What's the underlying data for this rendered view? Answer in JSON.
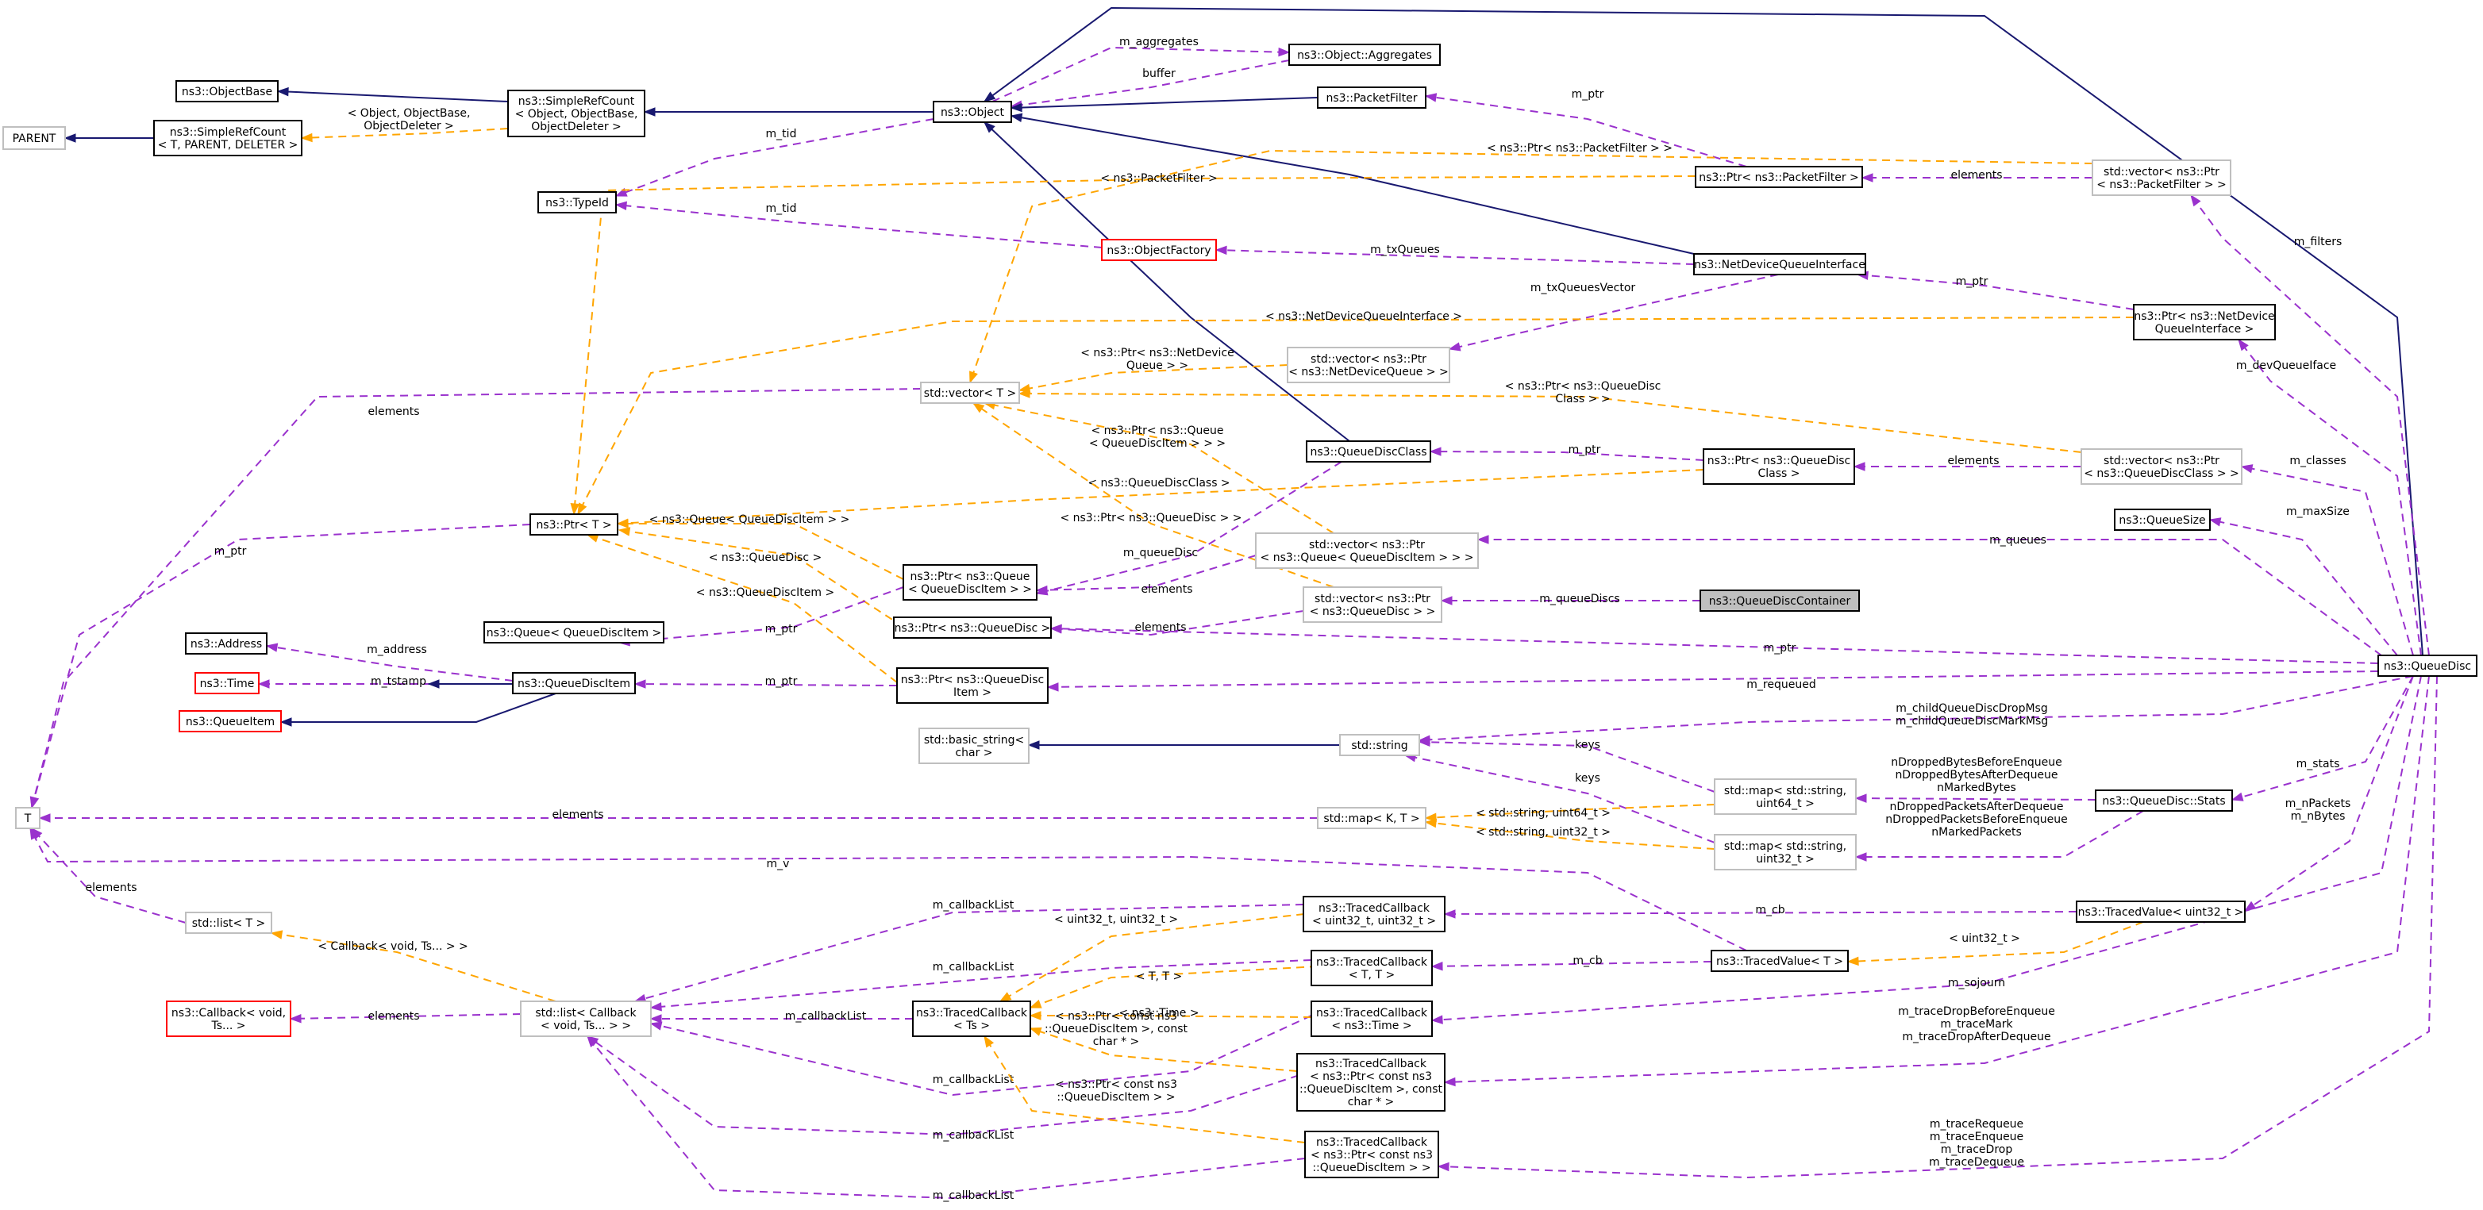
{
  "nodes": {
    "parent": [
      "PARENT"
    ],
    "objectbase": [
      "ns3::ObjectBase"
    ],
    "srcT": [
      "ns3::SimpleRefCount",
      "< T, PARENT, DELETER >"
    ],
    "srcObj": [
      "ns3::SimpleRefCount",
      "< Object, ObjectBase,",
      "ObjectDeleter >"
    ],
    "object": [
      "ns3::Object"
    ],
    "aggregates": [
      "ns3::Object::Aggregates"
    ],
    "packetfilter": [
      "ns3::PacketFilter"
    ],
    "typeid": [
      "ns3::TypeId"
    ],
    "objectfactory": [
      "ns3::ObjectFactory"
    ],
    "ptrPacketFilter": [
      "ns3::Ptr< ns3::PacketFilter >"
    ],
    "vecPtrPacketFilter": [
      "std::vector< ns3::Ptr",
      "< ns3::PacketFilter > >"
    ],
    "netdeviceqi": [
      "ns3::NetDeviceQueueInterface"
    ],
    "ptrNdqi": [
      "ns3::Ptr< ns3::NetDevice",
      "QueueInterface >"
    ],
    "vecPtrNdq": [
      "std::vector< ns3::Ptr",
      "< ns3::NetDeviceQueue > >"
    ],
    "vectorT": [
      "std::vector< T >"
    ],
    "queuediscclass": [
      "ns3::QueueDiscClass"
    ],
    "ptrQdc": [
      "ns3::Ptr< ns3::QueueDisc",
      "Class >"
    ],
    "vecPtrQdc": [
      "std::vector< ns3::Ptr",
      "< ns3::QueueDiscClass > >"
    ],
    "ptrT": [
      "ns3::Ptr< T >"
    ],
    "queuesize": [
      "ns3::QueueSize"
    ],
    "vecPtrQueue": [
      "std::vector< ns3::Ptr",
      "< ns3::Queue< QueueDiscItem > > >"
    ],
    "ptrQueue": [
      "ns3::Ptr< ns3::Queue",
      "< QueueDiscItem > >"
    ],
    "vecPtrQd": [
      "std::vector< ns3::Ptr",
      "< ns3::QueueDisc > >"
    ],
    "qdcontainer": [
      "ns3::QueueDiscContainer"
    ],
    "ptrQd": [
      "ns3::Ptr< ns3::QueueDisc >"
    ],
    "address": [
      "ns3::Address"
    ],
    "queueQdi": [
      "ns3::Queue< QueueDiscItem >"
    ],
    "time": [
      "ns3::Time"
    ],
    "queuediscitem": [
      "ns3::QueueDiscItem"
    ],
    "ptrQdi": [
      "ns3::Ptr< ns3::QueueDisc",
      "Item >"
    ],
    "queueitem": [
      "ns3::QueueItem"
    ],
    "queuedisc": [
      "ns3::QueueDisc"
    ],
    "basicstring": [
      "std::basic_string<",
      "char >"
    ],
    "stdstring": [
      "std::string"
    ],
    "mapU64": [
      "std::map< std::string,",
      "uint64_t >"
    ],
    "stats": [
      "ns3::QueueDisc::Stats"
    ],
    "T": [
      "T"
    ],
    "mapKT": [
      "std::map< K, T >"
    ],
    "mapU32": [
      "std::map< std::string,",
      "uint32_t >"
    ],
    "tcU32": [
      "ns3::TracedCallback",
      "< uint32_t, uint32_t >"
    ],
    "tracedvalueU32": [
      "ns3::TracedValue< uint32_t >"
    ],
    "listT": [
      "std::list< T >"
    ],
    "tcTT": [
      "ns3::TracedCallback",
      "< T, T >"
    ],
    "tracedvalueT": [
      "ns3::TracedValue< T >"
    ],
    "callback": [
      "ns3::Callback< void,",
      "Ts... >"
    ],
    "listCallback": [
      "std::list< Callback",
      "< void, Ts... > >"
    ],
    "tcTs": [
      "ns3::TracedCallback",
      "< Ts >"
    ],
    "tcTime": [
      "ns3::TracedCallback",
      "< ns3::Time >"
    ],
    "tcQdiChar": [
      "ns3::TracedCallback",
      "< ns3::Ptr< const ns3",
      "::QueueDiscItem >, const",
      "char * >"
    ],
    "tcQdi": [
      "ns3::TracedCallback",
      "< ns3::Ptr< const ns3",
      "::QueueDiscItem > >"
    ]
  },
  "edges": {
    "e1": [],
    "e2": [],
    "e3": [
      "< Object, ObjectBase,",
      "ObjectDeleter >"
    ],
    "e4": [],
    "e5": [
      "m_aggregates"
    ],
    "e6": [
      "buffer"
    ],
    "e7": [],
    "e8": [],
    "e9": [],
    "e10": [],
    "e11": [
      "m_tid"
    ],
    "e12": [
      "m_tid"
    ],
    "e13": [
      "m_ptr"
    ],
    "e14": [
      "< ns3::Ptr< ns3::PacketFilter > >"
    ],
    "e15": [
      "elements"
    ],
    "e16": [
      "< ns3::PacketFilter >"
    ],
    "e17": [
      "m_txQueues"
    ],
    "e18": [
      "m_txQueuesVector"
    ],
    "e19": [
      "m_ptr"
    ],
    "e20": [
      "< ns3::NetDeviceQueueInterface >"
    ],
    "e21": [
      "< ns3::Ptr< ns3::NetDevice",
      "Queue > >"
    ],
    "e22": [
      "< ns3::Ptr< ns3::QueueDisc",
      "Class > >"
    ],
    "e23": [
      "elements"
    ],
    "e24": [
      "elements"
    ],
    "e25": [
      "m_ptr"
    ],
    "e26": [
      "< ns3::QueueDiscClass >"
    ],
    "e27": [
      "m_ptr"
    ],
    "e28": [
      "< ns3::Queue< QueueDiscItem > >"
    ],
    "e29": [
      "< ns3::QueueDisc >"
    ],
    "e30": [
      "< ns3::QueueDiscItem >"
    ],
    "e31": [
      "< ns3::Ptr< ns3::Queue",
      "< QueueDiscItem > > >"
    ],
    "e32": [
      "< ns3::Ptr< ns3::QueueDisc > >"
    ],
    "e33": [
      "m_queueDisc"
    ],
    "e34": [
      "elements"
    ],
    "e35": [
      "m_queueDiscs"
    ],
    "e36": [
      "elements"
    ],
    "e37": [
      "m_ptr"
    ],
    "e38": [
      "m_ptr"
    ],
    "e39": [
      "m_address"
    ],
    "e40": [
      "m_tstamp"
    ],
    "e41": [],
    "e42": [
      "m_ptr"
    ],
    "e43": [
      "m_requeued"
    ],
    "e44": [],
    "e45": [
      "keys"
    ],
    "e46": [
      "keys"
    ],
    "e47": [
      "elements"
    ],
    "e48": [
      "< std::string, uint64_t >"
    ],
    "e49": [
      "< std::string, uint32_t >"
    ],
    "e50": [
      "nDroppedBytesBeforeEnqueue",
      "nDroppedBytesAfterDequeue",
      "nMarkedBytes"
    ],
    "e51": [
      "nDroppedPacketsAfterDequeue",
      "nDroppedPacketsBeforeEnqueue",
      "nMarkedPackets"
    ],
    "e52": [
      "m_v"
    ],
    "e53": [
      "elements"
    ],
    "e54": [
      "m_cb"
    ],
    "e55": [
      "< uint32_t >"
    ],
    "e56": [
      "m_cb"
    ],
    "e57": [
      "< Callback< void, Ts... > >"
    ],
    "e58": [
      "elements"
    ],
    "e59": [
      "m_callbackList"
    ],
    "e60": [
      "m_callbackList"
    ],
    "e61": [
      "m_callbackList"
    ],
    "e62": [
      "m_callbackList"
    ],
    "e63": [
      "m_callbackList"
    ],
    "e64": [
      "m_callbackList"
    ],
    "e65": [
      "< uint32_t, uint32_t >"
    ],
    "e66": [
      "< T, T >"
    ],
    "e67": [
      "< ns3::Time >"
    ],
    "e68": [
      "< ns3::Ptr< const ns3",
      "::QueueDiscItem >, const",
      "char * >"
    ],
    "e69": [
      "< ns3::Ptr< const ns3",
      "::QueueDiscItem > >"
    ],
    "e70": [],
    "e71": [
      "m_filters"
    ],
    "e72": [
      "m_devQueueIface"
    ],
    "e73": [
      "m_classes"
    ],
    "e74": [
      "m_maxSize"
    ],
    "e75": [
      "m_queues"
    ],
    "e76": [
      "m_childQueueDiscDropMsg",
      "m_childQueueDiscMarkMsg"
    ],
    "e77": [
      "m_stats"
    ],
    "e78": [
      "m_nPackets",
      "m_nBytes"
    ],
    "e79": [
      "m_sojourn"
    ],
    "e80": [
      "m_traceDropBeforeEnqueue",
      "m_traceMark",
      "m_traceDropAfterDequeue"
    ],
    "e81": [
      "m_traceRequeue",
      "m_traceEnqueue",
      "m_traceDrop",
      "m_traceDequeue"
    ]
  },
  "colors": {
    "inheritance": "#191970",
    "usage": "#9a32cd",
    "template": "#ffa500",
    "highlighted_node": "#bfbfbf",
    "undocumented_border": "#bfbfbf",
    "missing_border": "#ff0000"
  }
}
